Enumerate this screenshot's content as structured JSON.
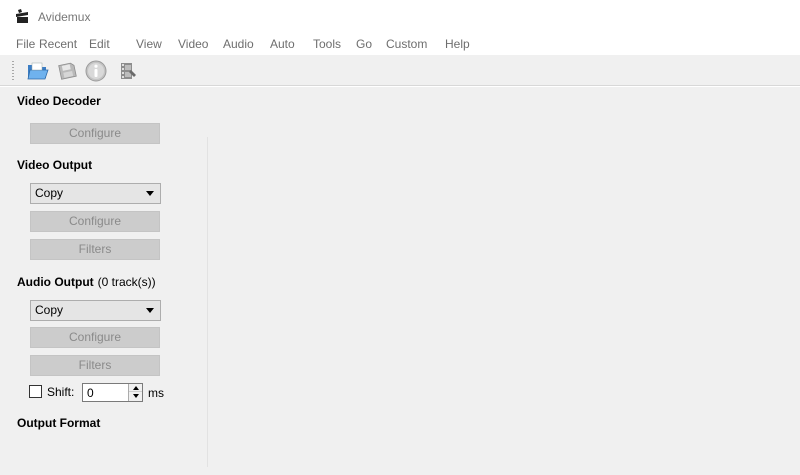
{
  "window": {
    "title": "Avidemux",
    "icon": "clapperboard-icon"
  },
  "menu": [
    "File",
    "Recent",
    "Edit",
    "View",
    "Video",
    "Audio",
    "Auto",
    "Tools",
    "Go",
    "Custom",
    "Help"
  ],
  "toolbar": {
    "buttons": [
      {
        "name": "open-folder-icon"
      },
      {
        "name": "save-disk-icon"
      },
      {
        "name": "info-icon"
      },
      {
        "name": "film-properties-icon"
      }
    ]
  },
  "video_decoder": {
    "title": "Video Decoder",
    "configure_label": "Configure"
  },
  "video_output": {
    "title": "Video Output",
    "codec": "Copy",
    "configure_label": "Configure",
    "filters_label": "Filters"
  },
  "audio_output": {
    "title": "Audio Output",
    "tracks": "(0 track(s))",
    "codec": "Copy",
    "configure_label": "Configure",
    "filters_label": "Filters",
    "shift_label": "Shift:",
    "shift_checked": false,
    "shift_value": "0",
    "shift_unit": "ms"
  },
  "output_format": {
    "title": "Output Format"
  },
  "colors": {
    "panel_bg": "#f0f0f0",
    "disabled_button": "#cccccc",
    "disabled_text": "#8a8a8a"
  }
}
